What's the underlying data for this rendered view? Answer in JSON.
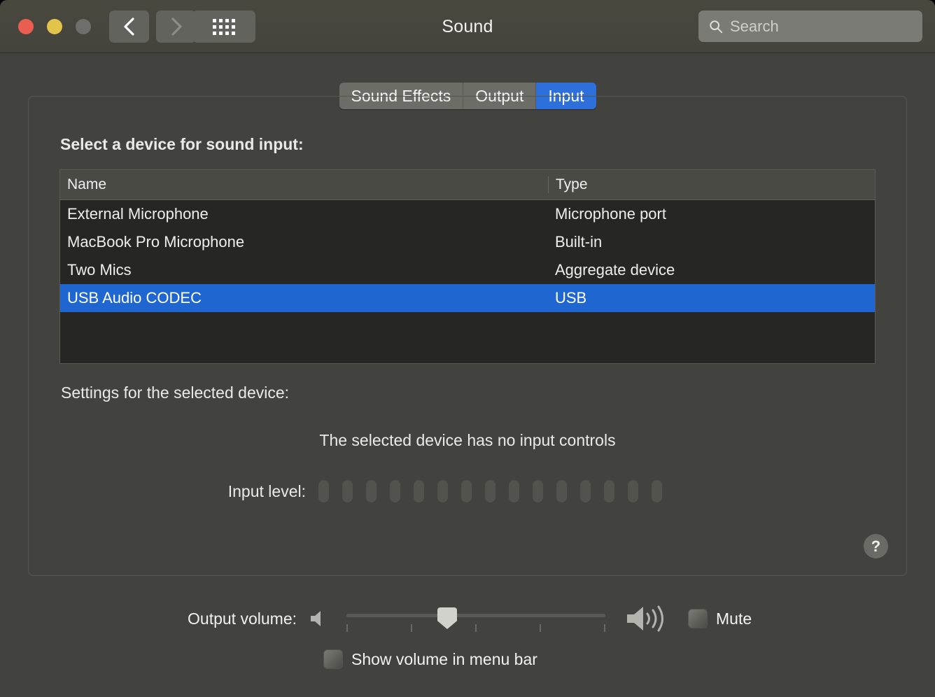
{
  "window": {
    "title": "Sound",
    "traffic_lights": [
      {
        "name": "close",
        "color": "#ea5e52"
      },
      {
        "name": "minimize",
        "color": "#e3c44a"
      },
      {
        "name": "zoom",
        "color": "#6e6e6a"
      }
    ],
    "nav": {
      "back_icon": "chevron-left-icon",
      "forward_icon": "chevron-right-icon",
      "grid_icon": "show-all-grid-icon"
    },
    "search": {
      "placeholder": "Search",
      "value": "",
      "icon": "search-icon"
    }
  },
  "tabs": [
    {
      "label": "Sound Effects",
      "active": false
    },
    {
      "label": "Output",
      "active": false
    },
    {
      "label": "Input",
      "active": true
    }
  ],
  "main": {
    "section_title": "Select a device for sound input:",
    "table": {
      "columns": [
        "Name",
        "Type"
      ],
      "rows": [
        {
          "name": "External Microphone",
          "type": "Microphone port",
          "selected": false
        },
        {
          "name": "MacBook Pro Microphone",
          "type": "Built-in",
          "selected": false
        },
        {
          "name": "Two Mics",
          "type": "Aggregate device",
          "selected": false
        },
        {
          "name": "USB Audio CODEC",
          "type": "USB",
          "selected": true
        }
      ]
    },
    "settings_label": "Settings for the selected device:",
    "no_controls_message": "The selected device has no input controls",
    "input_level": {
      "label": "Input level:",
      "segments": 15,
      "lit": 0
    },
    "help_button": {
      "label": "?",
      "icon": "question-mark-icon"
    }
  },
  "footer": {
    "output_volume_label": "Output volume:",
    "volume_low_icon": "speaker-muted-icon",
    "volume_high_icon": "speaker-loud-icon",
    "slider": {
      "value": 38,
      "min": 0,
      "max": 100,
      "ticks": 5
    },
    "mute": {
      "label": "Mute",
      "checked": false
    },
    "show_volume": {
      "label": "Show volume in menu bar",
      "checked": false
    }
  },
  "colors": {
    "accent": "#2d6fdb",
    "selection": "#1f66d0",
    "window_bg": "#42423f",
    "titlebar_bg": "#46463f",
    "table_bg": "#262625"
  }
}
